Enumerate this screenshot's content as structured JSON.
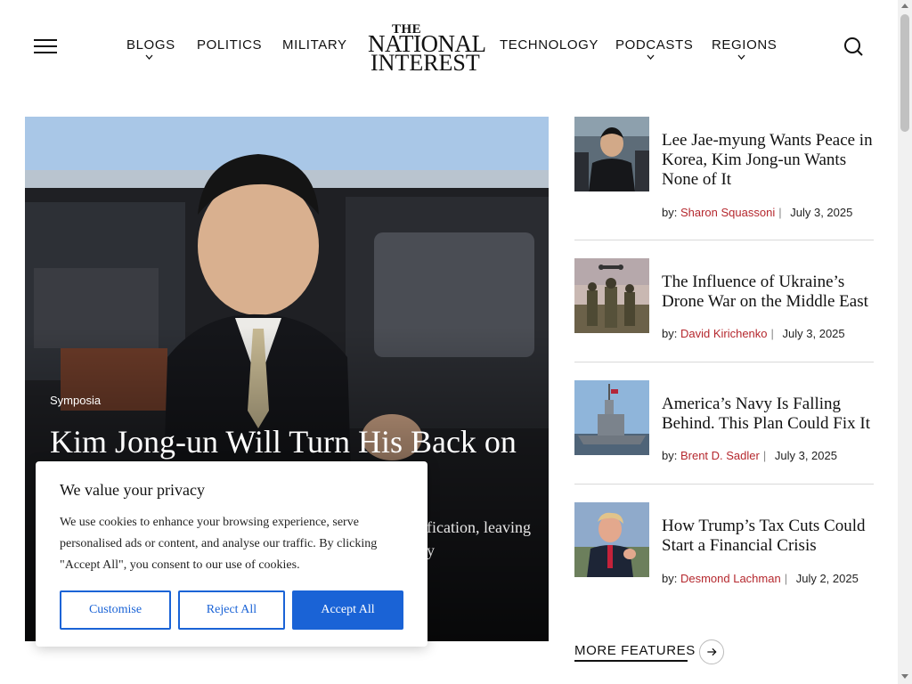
{
  "header": {
    "menu_icon": "hamburger-menu-icon",
    "nav_left": [
      {
        "label": "BLOGS",
        "has_dropdown": true
      },
      {
        "label": "POLITICS",
        "has_dropdown": false
      },
      {
        "label": "MILITARY",
        "has_dropdown": false
      }
    ],
    "logo": {
      "line1": "THE",
      "line2": "NATIONAL",
      "line3": "INTEREST"
    },
    "nav_right": [
      {
        "label": "TECHNOLOGY",
        "has_dropdown": false
      },
      {
        "label": "PODCASTS",
        "has_dropdown": true
      },
      {
        "label": "REGIONS",
        "has_dropdown": true
      }
    ],
    "search_icon": "search-icon"
  },
  "hero": {
    "category": "Symposia",
    "title": "Kim Jong-un Will Turn His Back on",
    "summary": "unification, leaving only"
  },
  "stories": [
    {
      "title": "Lee Jae-myung Wants Peace in Korea, Kim Jong-un Wants None of It",
      "by": "by:",
      "author": "Sharon Squassoni",
      "date": "July 3, 2025"
    },
    {
      "title": "The Influence of Ukraine’s Drone War on the Middle East",
      "by": "by:",
      "author": "David Kirichenko",
      "date": "July 3, 2025"
    },
    {
      "title": "America’s Navy Is Falling Behind. This Plan Could Fix It",
      "by": "by:",
      "author": "Brent D. Sadler",
      "date": "July 3, 2025"
    },
    {
      "title": "How Trump’s Tax Cuts Could Start a Financial Crisis",
      "by": "by:",
      "author": "Desmond Lachman",
      "date": "July 2, 2025"
    }
  ],
  "more_features": {
    "label": "MORE FEATURES",
    "icon": "arrow-right-icon"
  },
  "cookie": {
    "title": "We value your privacy",
    "text": "We use cookies to enhance your browsing experience, serve personalised ads or content, and analyse our traffic. By clicking \"Accept All\", you consent to our use of cookies.",
    "customise": "Customise",
    "reject": "Reject All",
    "accept": "Accept All"
  },
  "colors": {
    "accent_blue": "#1a63d6",
    "author_red": "#b5282e"
  }
}
